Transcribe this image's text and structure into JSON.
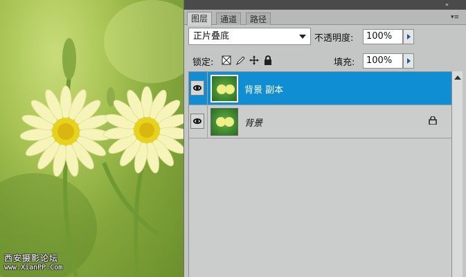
{
  "watermark": {
    "line1": "西安摄影论坛",
    "line2": "www.XianPP.Com"
  },
  "panel": {
    "collapse_icon": "«",
    "tabs": [
      {
        "label": "图层",
        "active": true
      },
      {
        "label": "通道",
        "active": false
      },
      {
        "label": "路径",
        "active": false
      }
    ],
    "menu_icon": "▾≡",
    "blend_mode": "正片叠底",
    "opacity_label": "不透明度:",
    "opacity_value": "100%",
    "lock_label": "锁定:",
    "fill_label": "填充:",
    "fill_value": "100%",
    "layers": [
      {
        "name": "背景 副本",
        "selected": true,
        "locked": false
      },
      {
        "name": "背景",
        "selected": false,
        "locked": true
      }
    ]
  },
  "colors": {
    "selection": "#0f8ed3",
    "panel_bg": "#c4c6c6",
    "titlebar": "#4a4a4a"
  }
}
